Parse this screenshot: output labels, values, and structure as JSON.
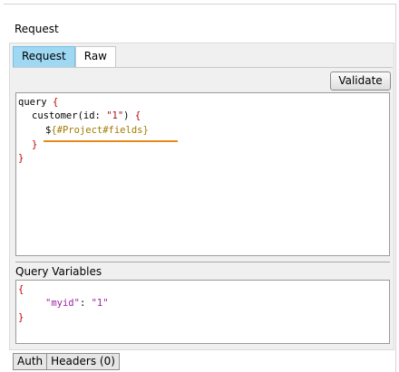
{
  "section_title": "Request",
  "tabs": [
    {
      "label": "Request",
      "active": true
    },
    {
      "label": "Raw",
      "active": false
    }
  ],
  "toolbar": {
    "validate_label": "Validate"
  },
  "editor": {
    "line1_keyword": "query",
    "line1_brace": "{",
    "line2_field": "customer(id: ",
    "line2_string": "\"1\"",
    "line2_close": ") ",
    "line2_brace": "{",
    "line3_dollar": "$",
    "line3_template": "{#Project#fields}",
    "line4_brace": "}",
    "line5_brace": "}"
  },
  "query_variables": {
    "label": "Query Variables",
    "line1": "{",
    "key": "\"myid\"",
    "colon": ": ",
    "value": "\"1\"",
    "line3": "}"
  },
  "bottom_tabs": [
    {
      "label": "Auth"
    },
    {
      "label": "Headers (0)"
    }
  ],
  "colors": {
    "active_tab": "#9fd8f2",
    "squiggle": "#e88a1a",
    "brace": "#c00000",
    "string": "#a31515",
    "template": "#a37a00",
    "json_key": "#a020a0"
  }
}
